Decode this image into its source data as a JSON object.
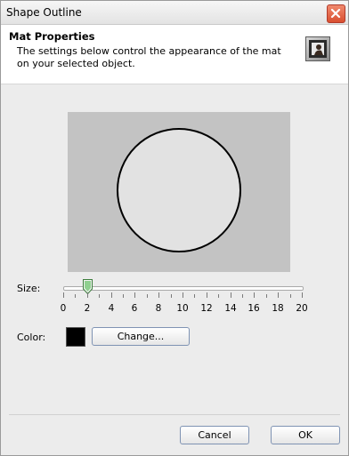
{
  "window": {
    "title": "Shape Outline"
  },
  "header": {
    "title": "Mat Properties",
    "description": "The settings below control the appearance of the mat on your selected object."
  },
  "size": {
    "label": "Size:",
    "value": 2,
    "min": 0,
    "max": 20,
    "tick_labels": [
      "0",
      "2",
      "4",
      "6",
      "8",
      "10",
      "12",
      "14",
      "16",
      "18",
      "20"
    ]
  },
  "color": {
    "label": "Color:",
    "value": "#000000",
    "change_label": "Change..."
  },
  "footer": {
    "cancel_label": "Cancel",
    "ok_label": "OK"
  }
}
